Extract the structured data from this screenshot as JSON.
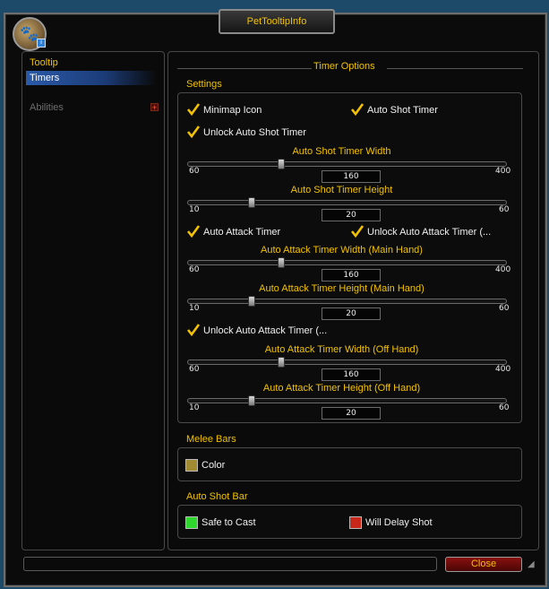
{
  "window": {
    "title": "PetTooltipInfo"
  },
  "sidebar": {
    "items": [
      {
        "label": "Tooltip"
      },
      {
        "label": "Timers"
      },
      {
        "label": "Abilities"
      }
    ]
  },
  "panel": {
    "title": "Timer Options",
    "settings": {
      "title": "Settings",
      "minimap_icon": {
        "label": "Minimap Icon",
        "checked": true
      },
      "auto_shot_timer": {
        "label": "Auto Shot Timer",
        "checked": true
      },
      "unlock_auto_shot": {
        "label": "Unlock Auto Shot Timer",
        "checked": true
      },
      "auto_shot_width": {
        "label": "Auto Shot Timer Width",
        "min": "60",
        "max": "400",
        "value": "160",
        "fraction": 0.294
      },
      "auto_shot_height": {
        "label": "Auto Shot Timer Height",
        "min": "10",
        "max": "60",
        "value": "20",
        "fraction": 0.2
      },
      "auto_attack_timer": {
        "label": "Auto Attack Timer",
        "checked": true
      },
      "unlock_auto_attack_main": {
        "label": "Unlock Auto Attack Timer (...",
        "checked": true
      },
      "aa_width_main": {
        "label": "Auto Attack Timer Width (Main Hand)",
        "min": "60",
        "max": "400",
        "value": "160",
        "fraction": 0.294
      },
      "aa_height_main": {
        "label": "Auto Attack Timer Height (Main Hand)",
        "min": "10",
        "max": "60",
        "value": "20",
        "fraction": 0.2
      },
      "unlock_auto_attack_off": {
        "label": "Unlock Auto Attack Timer (...",
        "checked": true
      },
      "aa_width_off": {
        "label": "Auto Attack Timer Width (Off Hand)",
        "min": "60",
        "max": "400",
        "value": "160",
        "fraction": 0.294
      },
      "aa_height_off": {
        "label": "Auto Attack Timer Height (Off Hand)",
        "min": "10",
        "max": "60",
        "value": "20",
        "fraction": 0.2
      }
    },
    "melee_bars": {
      "title": "Melee Bars",
      "color": {
        "label": "Color",
        "swatch": "#a08a32"
      }
    },
    "auto_shot_bar": {
      "title": "Auto Shot Bar",
      "safe": {
        "label": "Safe to Cast",
        "swatch": "#2ed62e"
      },
      "delay": {
        "label": "Will Delay Shot",
        "swatch": "#c8281a"
      }
    }
  },
  "footer": {
    "close_label": "Close"
  }
}
